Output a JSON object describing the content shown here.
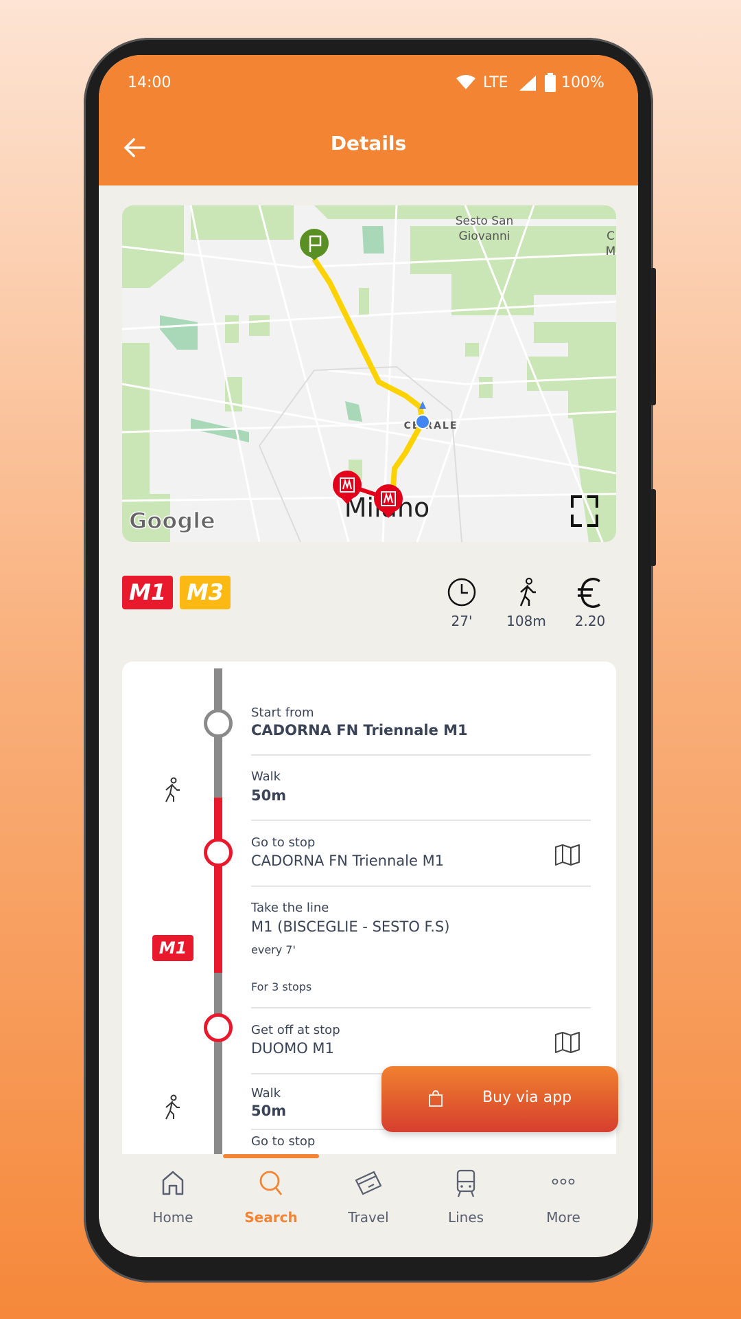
{
  "status_bar": {
    "time": "14:00",
    "network": "LTE",
    "battery": "100%"
  },
  "header": {
    "title": "Details",
    "back_icon": "arrow-left-icon"
  },
  "map": {
    "labels": {
      "sesto_1": "Sesto San",
      "sesto_2": "Giovanni",
      "centrale": "CE  RALE",
      "city": "Milano",
      "edge_1": "C",
      "edge_2": "M"
    },
    "logo": "Google",
    "colors": {
      "m3_route": "#fcd200",
      "m1_route": "#e3001b",
      "park": "#c9e6b0"
    }
  },
  "summary": {
    "lines": [
      {
        "label": "M1",
        "color": "#e8192c"
      },
      {
        "label": "M3",
        "color": "#fdb913"
      }
    ],
    "duration": "27'",
    "walk": "108m",
    "price": "2.20"
  },
  "steps": [
    {
      "label": "Start from",
      "value": "CADORNA FN Triennale M1"
    },
    {
      "label": "Walk",
      "value": "50m"
    },
    {
      "label": "Go to stop",
      "value": "CADORNA FN Triennale M1"
    },
    {
      "label": "Take the line",
      "value": "M1 (BISCEGLIE - SESTO F.S)",
      "frequency": "every 7'",
      "stops": "For 3 stops",
      "badge": "M1"
    },
    {
      "label": "Get off at stop",
      "value": "DUOMO M1"
    },
    {
      "label": "Walk",
      "value": "50m"
    },
    {
      "label": "Go to stop"
    }
  ],
  "buy_button": {
    "label": "Buy via app"
  },
  "nav": {
    "items": [
      {
        "label": "Home"
      },
      {
        "label": "Search",
        "active": true
      },
      {
        "label": "Travel"
      },
      {
        "label": "Lines"
      },
      {
        "label": "More"
      }
    ],
    "accent": "#f38433"
  }
}
